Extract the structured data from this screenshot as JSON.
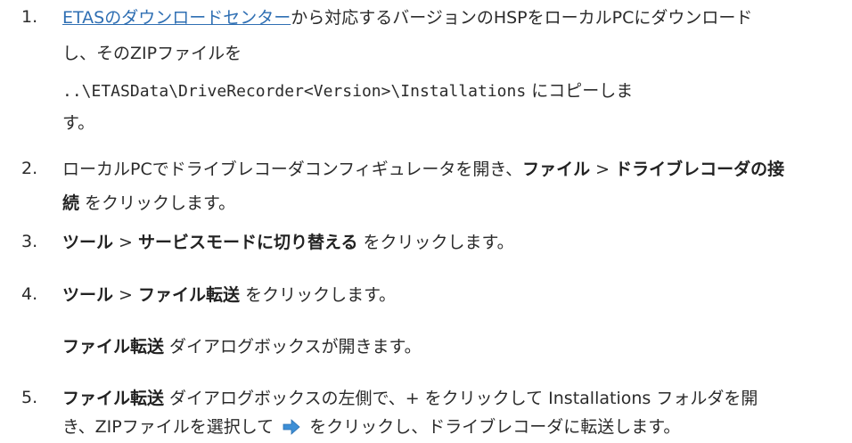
{
  "steps": [
    {
      "num": "1.",
      "link_text": "ETASのダウンロードセンター",
      "line1_tail": "から対応するバージョンのHSPをローカルPCにダウンロード",
      "line2": "し、そのZIPファイルを",
      "path": "..\\ETASData\\DriveRecorder<Version>\\Installations",
      "line3_tail": " にコピーしま",
      "line4": "す。"
    },
    {
      "num": "2.",
      "line1_pre": "ローカルPCでドライブレコーダコンフィギュレータを開き、",
      "menu1": "ファイル",
      "sep": " > ",
      "menu2a": "ドライブレコーダの接",
      "menu2b": "続",
      "tail": " をクリックします。"
    },
    {
      "num": "3.",
      "menu1": "ツール",
      "sep": " > ",
      "menu2": "サービスモードに切り替える",
      "tail": " をクリックします。"
    },
    {
      "num": "4.",
      "menu1": "ツール",
      "sep": " > ",
      "menu2": "ファイル転送",
      "tail": " をクリックします。",
      "result_bold": "ファイル転送",
      "result_tail": " ダイアログボックスが開きます。"
    },
    {
      "num": "5.",
      "bold": "ファイル転送",
      "line1_tail": " ダイアログボックスの左側で、+ をクリックして Installations フォルダを開",
      "line2_pre": "き、ZIPファイルを選択して ",
      "line2_tail": " をクリックし、ドライブレコーダに転送します。"
    }
  ],
  "icons": {
    "transfer": "right-arrow-icon",
    "arrow_color": "#3d8fd6"
  }
}
